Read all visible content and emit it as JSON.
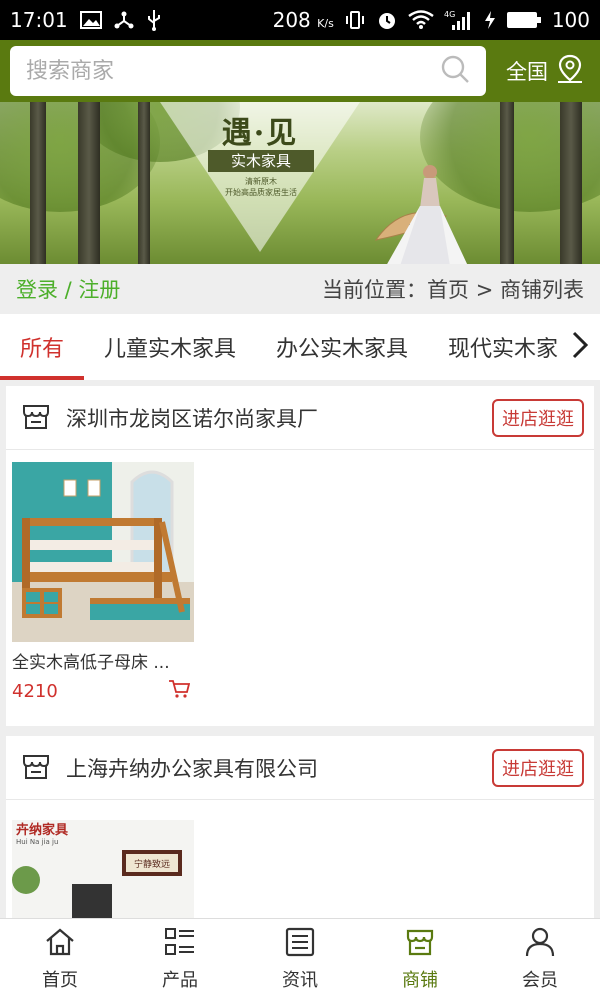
{
  "statusbar": {
    "time": "17:01",
    "speed": "208",
    "speed_unit": "K/s",
    "battery": "100",
    "network": "4G"
  },
  "search": {
    "placeholder": "搜索商家",
    "region": "全国"
  },
  "banner": {
    "title": "遇·见",
    "subtitle": "实木家具",
    "line1": "清新原木",
    "line2": "开始高品质家居生活"
  },
  "location": {
    "login": "登录 / 注册",
    "position": "当前位置：首页 > 商铺列表"
  },
  "tabs": [
    "所有",
    "儿童实木家具",
    "办公实木家具",
    "现代实木家"
  ],
  "stores": [
    {
      "name": "深圳市龙岗区诺尔尚家具厂",
      "button": "进店逛逛",
      "product_name": "全实木高低子母床 ...",
      "price": "4210"
    },
    {
      "name": "上海卉纳办公家具有限公司",
      "button": "进店逛逛",
      "product_sign": "卉纳家具",
      "product_sign_pinyin": "Hui Na jia ju",
      "product_painting": "宁静致远"
    }
  ],
  "nav": [
    {
      "label": "首页",
      "icon": "home-icon"
    },
    {
      "label": "产品",
      "icon": "list-icon"
    },
    {
      "label": "资讯",
      "icon": "news-icon"
    },
    {
      "label": "商铺",
      "icon": "store-icon"
    },
    {
      "label": "会员",
      "icon": "user-icon"
    }
  ],
  "colors": {
    "header": "#5a7a10",
    "accent": "#d0312d",
    "login": "#4caf2a"
  }
}
